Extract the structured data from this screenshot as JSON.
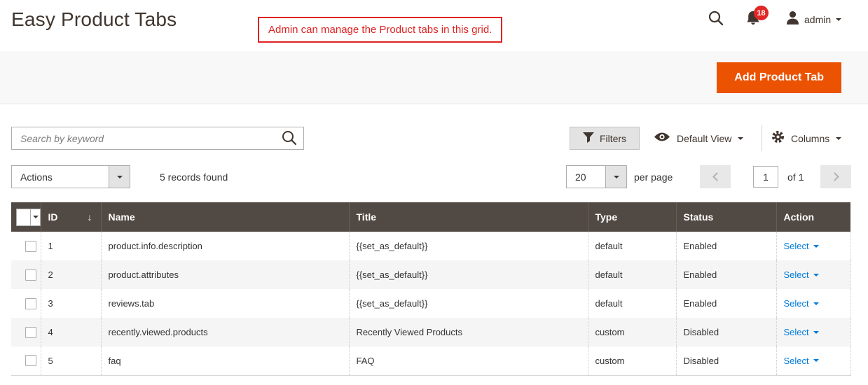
{
  "header": {
    "title": "Easy Product Tabs",
    "annotation": "Admin can manage the Product tabs in this grid.",
    "notification_badge": "18",
    "username": "admin"
  },
  "actions_bar": {
    "add_button": "Add Product Tab"
  },
  "grid_controls": {
    "search_placeholder": "Search by keyword",
    "filters": "Filters",
    "view": "Default View",
    "columns": "Columns",
    "actions": "Actions",
    "records_found": "5 records found",
    "per_page_value": "20",
    "per_page_label": "per page",
    "current_page": "1",
    "total_pages": "of 1"
  },
  "table": {
    "columns": [
      "ID",
      "Name",
      "Title",
      "Type",
      "Status",
      "Action"
    ],
    "sort_column": "ID",
    "sort_icon": "↓",
    "rows": [
      {
        "id": "1",
        "name": "product.info.description",
        "title": "{{set_as_default}}",
        "type": "default",
        "status": "Enabled",
        "action": "Select"
      },
      {
        "id": "2",
        "name": "product.attributes",
        "title": "{{set_as_default}}",
        "type": "default",
        "status": "Enabled",
        "action": "Select"
      },
      {
        "id": "3",
        "name": "reviews.tab",
        "title": "{{set_as_default}}",
        "type": "default",
        "status": "Enabled",
        "action": "Select"
      },
      {
        "id": "4",
        "name": "recently.viewed.products",
        "title": "Recently Viewed Products",
        "type": "custom",
        "status": "Disabled",
        "action": "Select"
      },
      {
        "id": "5",
        "name": "faq",
        "title": "FAQ",
        "type": "custom",
        "status": "Disabled",
        "action": "Select"
      }
    ]
  },
  "colors": {
    "accent_orange": "#eb5202",
    "link_blue": "#007bdb",
    "grid_header": "#514943",
    "badge_red": "#e22626",
    "annotation_red": "#e02222",
    "alt_row": "#f5f5f5"
  }
}
